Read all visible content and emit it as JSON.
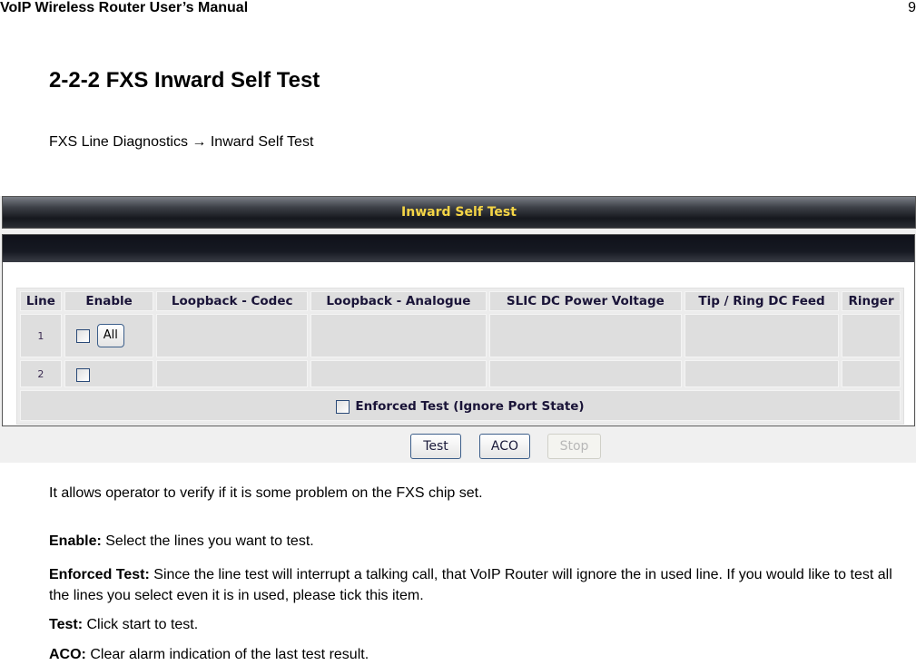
{
  "header": {
    "title": "VoIP Wireless Router User’s Manual",
    "page_number": "9"
  },
  "section": {
    "title": "2-2-2 FXS Inward Self Test",
    "nav_path": "FXS Line Diagnostics → Inward Self Test"
  },
  "screenshot": {
    "title": "Inward Self Test",
    "columns": [
      "Line",
      "Enable",
      "Loopback - Codec",
      "Loopback - Analogue",
      "SLIC DC Power Voltage",
      "Tip / Ring DC Feed",
      "Ringer"
    ],
    "rows": [
      {
        "line": "1",
        "enabled": false,
        "has_all_button": true
      },
      {
        "line": "2",
        "enabled": false,
        "has_all_button": false
      }
    ],
    "all_button_label": "All",
    "enforced_test": {
      "label": "Enforced Test (Ignore Port State)",
      "checked": false
    },
    "buttons": {
      "test": "Test",
      "aco": "ACO",
      "stop": "Stop"
    },
    "stop_disabled": true
  },
  "body": {
    "intro": "It allows operator to verify if it is some problem on the FXS chip set.",
    "items": [
      {
        "term": "Enable:",
        "desc": " Select the lines you want to test."
      },
      {
        "term": "Enforced Test:",
        "desc": " Since the line test will interrupt a talking call, that VoIP Router will ignore the in used line. If you would like to test all the lines you select even it is in used, please tick this item."
      },
      {
        "term": "Test:",
        "desc": " Click start to test."
      },
      {
        "term": "ACO:",
        "desc": " Clear alarm indication of the last test result."
      }
    ]
  }
}
